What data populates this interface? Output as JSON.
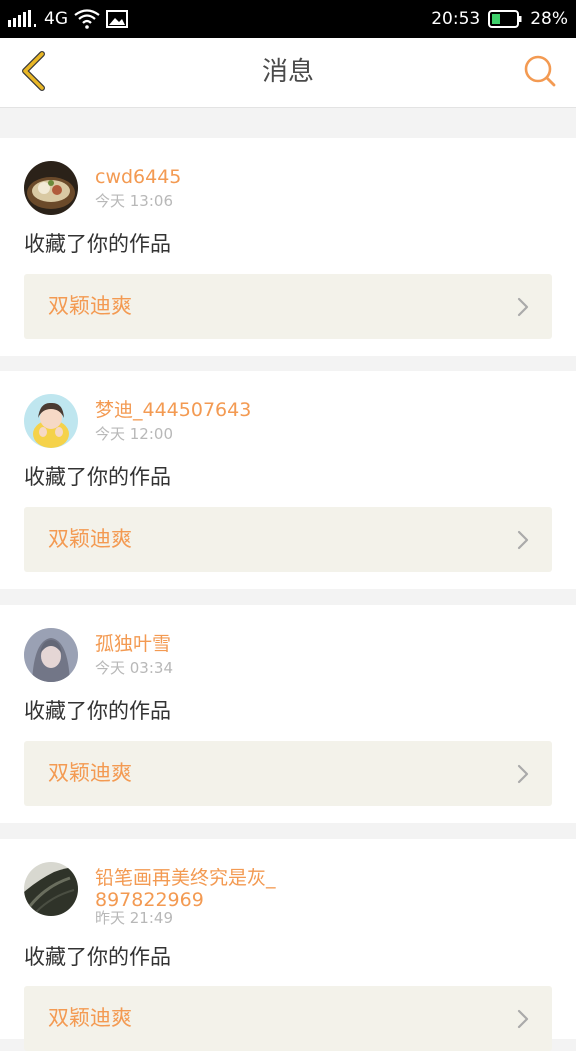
{
  "status_bar": {
    "network": "4G",
    "time": "20:53",
    "battery": "28%"
  },
  "header": {
    "title": "消息"
  },
  "messages": [
    {
      "username": "cwd6445",
      "time": "今天 13:06",
      "action": "收藏了你的作品",
      "work_title": "双颖迪爽"
    },
    {
      "username": "梦迪_444507643",
      "time": "今天 12:00",
      "action": "收藏了你的作品",
      "work_title": "双颖迪爽"
    },
    {
      "username": "孤独叶雪",
      "time": "今天 03:34",
      "action": "收藏了你的作品",
      "work_title": "双颖迪爽"
    },
    {
      "username": "铅笔画再美终究是灰_897822969",
      "time": "昨天 21:49",
      "action": "收藏了你的作品",
      "work_title": "双颖迪爽"
    }
  ],
  "colors": {
    "accent": "#f39a52",
    "back_arrow": "#e9b726",
    "work_bar": "#f3f2ea"
  },
  "icons": {
    "back": "chevron-left-icon",
    "search": "search-icon",
    "chevron": "chevron-right-icon"
  }
}
